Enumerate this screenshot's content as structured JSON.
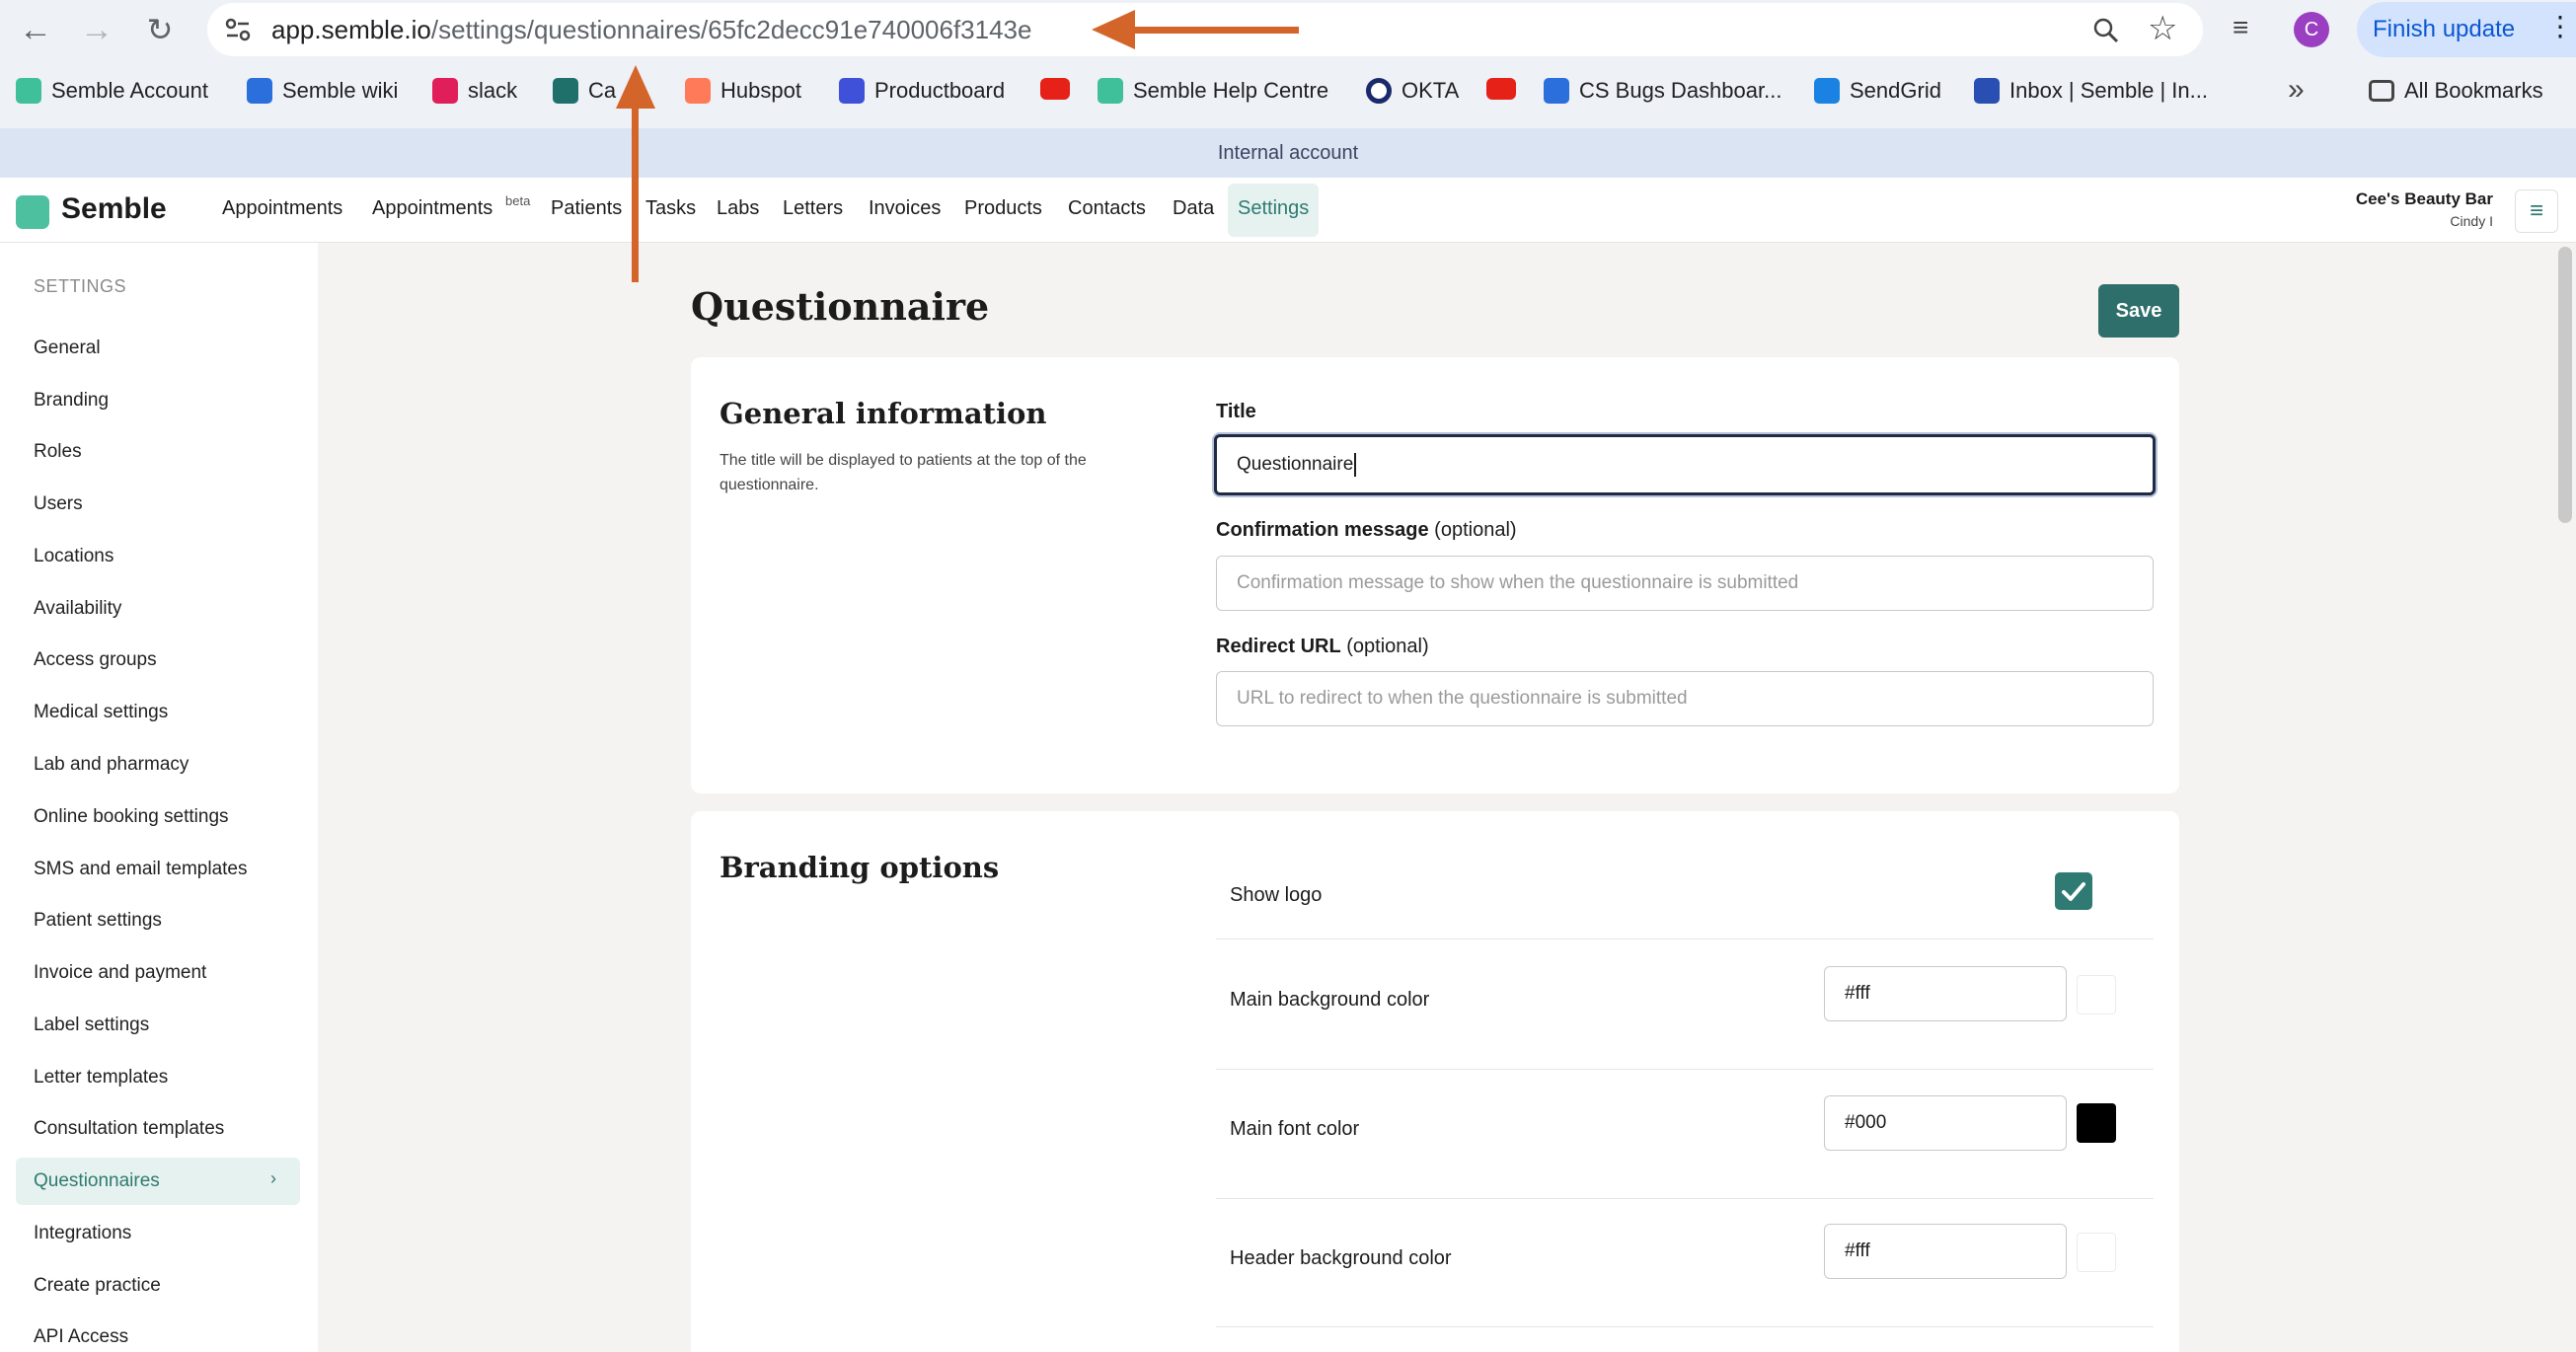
{
  "browser": {
    "url_host": "app.semble.io",
    "url_path": "/settings/questionnaires/65fc2decc91e740006f3143e",
    "finish_update": "Finish update",
    "profile_initial": "C",
    "bookmarks": [
      {
        "label": "Semble Account",
        "color": "#3fbf9a"
      },
      {
        "label": "Semble wiki",
        "color": "#2a6fdb"
      },
      {
        "label": "slack",
        "color": "#e01e5a"
      },
      {
        "label": "Ca",
        "color": "#1f6f6a"
      },
      {
        "label": "Hubspot",
        "color": "#ff7a59"
      },
      {
        "label": "Productboard",
        "color": "#3f51d9"
      },
      {
        "label": "",
        "color": "#e62117"
      },
      {
        "label": "Semble Help Centre",
        "color": "#3fbf9a"
      },
      {
        "label": "OKTA",
        "color": "#1a2a6c"
      },
      {
        "label": "",
        "color": "#e62117"
      },
      {
        "label": "CS Bugs Dashboar...",
        "color": "#2a6fdb"
      },
      {
        "label": "SendGrid",
        "color": "#1a82e2"
      },
      {
        "label": "Inbox | Semble | In...",
        "color": "#2a4fb3"
      }
    ],
    "all_bookmarks": "All Bookmarks"
  },
  "banner": "Internal account",
  "app": {
    "logo_text": "Semble",
    "nav": [
      "Appointments",
      "Appointments",
      "Patients",
      "Tasks",
      "Labs",
      "Letters",
      "Invoices",
      "Products",
      "Contacts",
      "Data",
      "Settings"
    ],
    "beta": "beta",
    "org_name": "Cee's Beauty Bar",
    "user_name": "Cindy I"
  },
  "sidebar": {
    "heading": "SETTINGS",
    "items": [
      "General",
      "Branding",
      "Roles",
      "Users",
      "Locations",
      "Availability",
      "Access groups",
      "Medical settings",
      "Lab and pharmacy",
      "Online booking settings",
      "SMS and email templates",
      "Patient settings",
      "Invoice and payment",
      "Label settings",
      "Letter templates",
      "Consultation templates",
      "Questionnaires",
      "Integrations",
      "Create practice",
      "API Access"
    ],
    "active_index": 16
  },
  "page": {
    "title": "Questionnaire",
    "save_label": "Save"
  },
  "general": {
    "title": "General information",
    "help": "The title will be displayed to patients at the top of the questionnaire.",
    "title_label": "Title",
    "title_value": "Questionnaire",
    "confirm_label": "Confirmation message",
    "confirm_optional": "(optional)",
    "confirm_placeholder": "Confirmation message to show when the questionnaire is submitted",
    "redirect_label": "Redirect URL",
    "redirect_optional": "(optional)",
    "redirect_placeholder": "URL to redirect to when the questionnaire is submitted"
  },
  "branding": {
    "title": "Branding options",
    "show_logo_label": "Show logo",
    "show_logo_checked": true,
    "rows": [
      {
        "label": "Main background color",
        "value": "#fff",
        "swatch": "#ffffff"
      },
      {
        "label": "Main font color",
        "value": "#000",
        "swatch": "#000000"
      },
      {
        "label": "Header background color",
        "value": "#fff",
        "swatch": "#ffffff"
      }
    ]
  }
}
